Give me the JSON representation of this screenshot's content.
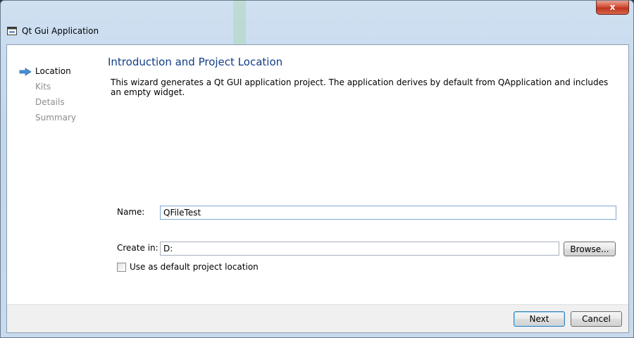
{
  "window": {
    "title": "Qt Gui Application",
    "close_label": "x"
  },
  "wizard": {
    "steps": [
      {
        "label": "Location",
        "state": "current"
      },
      {
        "label": "Kits",
        "state": "future"
      },
      {
        "label": "Details",
        "state": "future"
      },
      {
        "label": "Summary",
        "state": "future"
      }
    ],
    "heading": "Introduction and Project Location",
    "description": "This wizard generates a Qt GUI application project. The application derives by default from QApplication and includes an empty widget.",
    "name_label": "Name:",
    "name_value": "QFileTest",
    "create_in_label": "Create in:",
    "create_in_value": "D:",
    "browse_label": "Browse...",
    "default_location_label": "Use as default project location",
    "default_location_checked": false,
    "next_label": "Next",
    "cancel_label": "Cancel"
  },
  "colors": {
    "heading": "#103e86",
    "step_current": "#000000",
    "step_future": "#8d8d8d",
    "arrow": "#4a8fd6"
  },
  "icons": {
    "app": "window-icon",
    "step_marker": "arrow-right-icon"
  }
}
